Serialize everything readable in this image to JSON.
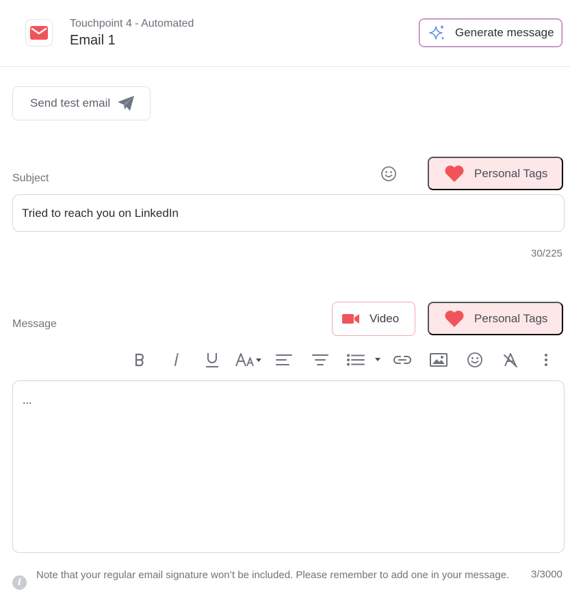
{
  "header": {
    "subtitle": "Touchpoint 4 - Automated",
    "title": "Email 1",
    "generate_label": "Generate message"
  },
  "actions": {
    "send_test_label": "Send test email"
  },
  "subject": {
    "label": "Subject",
    "value": "Tried to reach you on LinkedIn",
    "counter": "30/225",
    "personal_tags_label": "Personal Tags"
  },
  "message": {
    "label": "Message",
    "video_label": "Video",
    "personal_tags_label": "Personal Tags",
    "body": "...",
    "counter": "3/3000",
    "note": "Note that your regular email signature won’t be included. Please remember to add one in your message."
  },
  "toolbar": {
    "items": [
      "bold-icon",
      "italic-icon",
      "underline-icon",
      "font-size-icon",
      "align-left-icon",
      "align-center-icon",
      "bulleted-list-icon",
      "link-icon",
      "image-icon",
      "emoji-icon",
      "clear-format-icon",
      "more-icon"
    ]
  },
  "colors": {
    "accent_red": "#f0545a",
    "tag_bg": "#fde7e8",
    "sparkle_blue": "#5b8fe6"
  }
}
